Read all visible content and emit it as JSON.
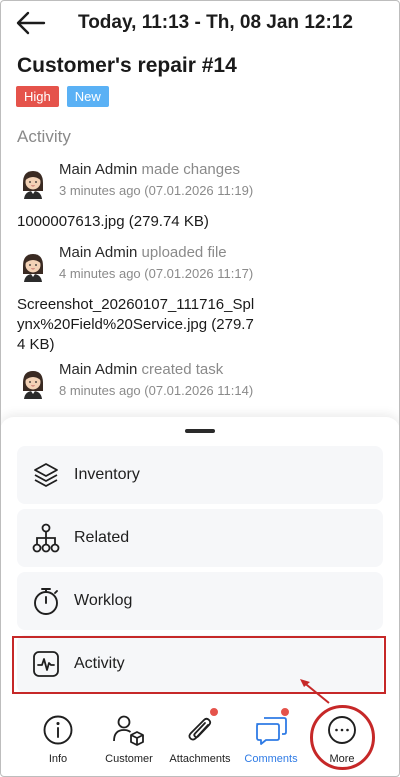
{
  "header": {
    "title": "Today, 11:13 - Th, 08 Jan 12:12"
  },
  "task": {
    "title": "Customer's repair #14",
    "badges": [
      "High",
      "New"
    ],
    "colors": {
      "high": "#e5534b",
      "new": "#5ab1f5"
    }
  },
  "activity": {
    "section_title": "Activity",
    "entries": [
      {
        "author": "Main Admin",
        "action": "made changes",
        "time": "3 minutes ago (07.01.2026 11:19)",
        "detail": "1000007613.jpg (279.74 KB)"
      },
      {
        "author": "Main Admin",
        "action": "uploaded file",
        "time": "4 minutes ago (07.01.2026 11:17)",
        "detail": "Screenshot_20260107_111716_Splynx%20Field%20Service.jpg (279.74 KB)"
      },
      {
        "author": "Main Admin",
        "action": "created task",
        "time": "8 minutes ago (07.01.2026 11:14)",
        "detail": ""
      }
    ]
  },
  "sheet": {
    "items": [
      {
        "label": "Inventory",
        "icon": "layers-icon"
      },
      {
        "label": "Related",
        "icon": "hierarchy-icon"
      },
      {
        "label": "Worklog",
        "icon": "stopwatch-icon"
      },
      {
        "label": "Activity",
        "icon": "activity-pulse-icon"
      }
    ]
  },
  "nav": {
    "items": [
      {
        "label": "Info",
        "icon": "info-icon"
      },
      {
        "label": "Customer",
        "icon": "customer-icon"
      },
      {
        "label": "Attachments",
        "icon": "paperclip-icon"
      },
      {
        "label": "Comments",
        "icon": "comments-icon"
      },
      {
        "label": "More",
        "icon": "more-icon"
      }
    ],
    "active_color": "#2f7be5"
  },
  "annotation_color": "#c62828"
}
